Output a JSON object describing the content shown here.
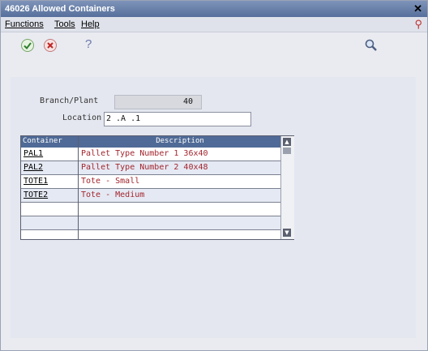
{
  "window": {
    "title": "46026  Allowed Containers"
  },
  "menus": [
    "Functions",
    "Tools",
    "Help"
  ],
  "icons": {
    "ok": "check-icon",
    "cancel": "cancel-icon",
    "help": "help-icon",
    "find": "search-icon"
  },
  "toolbar": {
    "help_glyph": "?"
  },
  "form": {
    "branch_plant_label": "Branch/Plant",
    "branch_plant_value": "40",
    "location_label": "Location",
    "location_value": "2 .A  .1"
  },
  "grid": {
    "headers": [
      "Container",
      "Description"
    ],
    "rows": [
      {
        "container": "PAL1",
        "description": "Pallet Type Number 1   36x40"
      },
      {
        "container": "PAL2",
        "description": "Pallet Type Number 2  40x48"
      },
      {
        "container": "TOTE1",
        "description": "Tote - Small"
      },
      {
        "container": "TOTE2",
        "description": "Tote - Medium"
      },
      {
        "container": "",
        "description": ""
      },
      {
        "container": "",
        "description": ""
      },
      {
        "container": "",
        "description": ""
      }
    ]
  },
  "colors": {
    "title_bar": "#56709c",
    "grid_header": "#4f6a96",
    "description_text": "#a3262e"
  }
}
